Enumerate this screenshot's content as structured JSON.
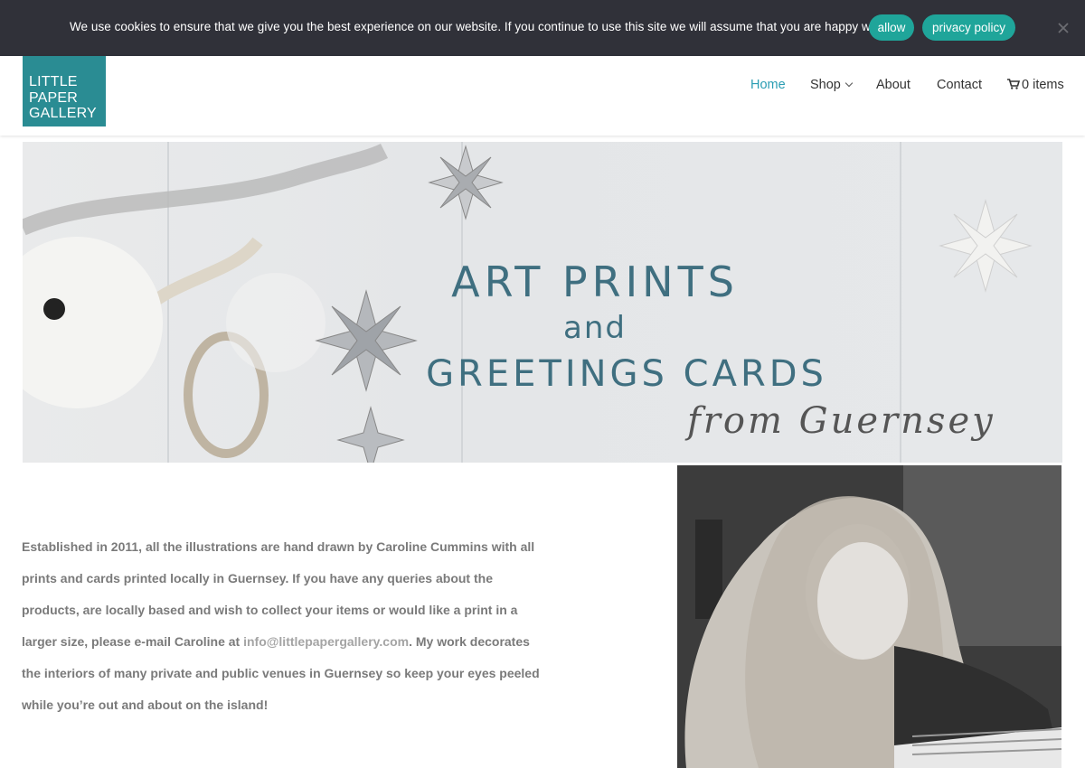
{
  "cookie_bar": {
    "message": "We use cookies to ensure that we give you the best experience on our website. If you continue to use this site we will assume that you are happy with it.",
    "allow_label": "allow",
    "privacy_label": "privacy policy",
    "close_icon": "close-icon",
    "accent_color": "#1fa59a"
  },
  "header": {
    "logo_lines": [
      "LITTLE",
      "PAPER",
      "GALLERY"
    ],
    "logo_color": "#2a8c93",
    "nav": {
      "home": "Home",
      "shop": "Shop",
      "about": "About",
      "contact": "Contact",
      "cart": "0 items"
    },
    "active_color": "#2a9db3",
    "cart_icon": "cart-icon",
    "dropdown_icon": "chevron-down-icon"
  },
  "hero": {
    "line1": "ART PRINTS",
    "line2": "and",
    "line3": "GREETINGS CARDS",
    "line4": "from Guernsey"
  },
  "intro": {
    "text_before": "Established in 2011, all the illustrations are hand drawn by Caroline Cummins with all prints and cards printed locally in Guernsey. If you have any queries about the products, are locally based and wish to collect your items or would like a print in a larger size, please e-mail Caroline at ",
    "email": "info@littlepapergallery.com",
    "text_after": ". My work decorates the interiors of many private and public venues in Guernsey so keep your eyes peeled while you’re out and about on the island!"
  }
}
